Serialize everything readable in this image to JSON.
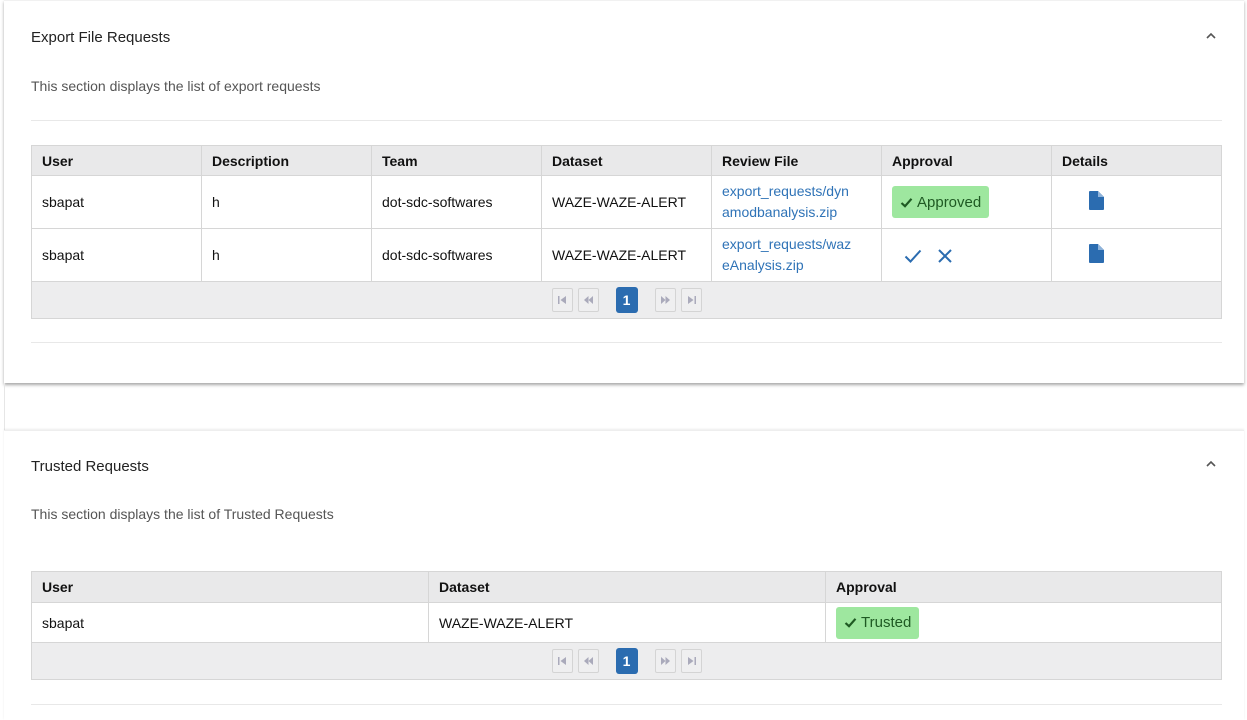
{
  "export_section": {
    "title": "Export File Requests",
    "description": "This section displays the list of export requests",
    "columns": [
      "User",
      "Description",
      "Team",
      "Dataset",
      "Review File",
      "Approval",
      "Details"
    ],
    "rows": [
      {
        "user": "sbapat",
        "description": "h",
        "team": "dot-sdc-softwares",
        "dataset": "WAZE-WAZE-ALERT",
        "review_file_line1": "export_requests/dyn",
        "review_file_line2": "amodbanalysis.zip",
        "approval": "Approved"
      },
      {
        "user": "sbapat",
        "description": "h",
        "team": "dot-sdc-softwares",
        "dataset": "WAZE-WAZE-ALERT",
        "review_file_line1": "export_requests/waz",
        "review_file_line2": "eAnalysis.zip",
        "approval": ""
      }
    ],
    "pager": {
      "current_page": "1"
    }
  },
  "trusted_section": {
    "title": "Trusted Requests",
    "description": "This section displays the list of Trusted Requests",
    "columns": [
      "User",
      "Dataset",
      "Approval"
    ],
    "rows": [
      {
        "user": "sbapat",
        "dataset": "WAZE-WAZE-ALERT",
        "approval": "Trusted"
      }
    ],
    "pager": {
      "current_page": "1"
    }
  },
  "colors": {
    "link": "#2f73b7",
    "badge_bg": "#9ee79f",
    "badge_text": "#1f5a23",
    "page_active": "#2b6cb0",
    "icon_blue": "#2b6cb0"
  },
  "icons": [
    "chevron-up-icon",
    "check-icon",
    "close-icon",
    "document-icon",
    "first-page-icon",
    "prev-page-icon",
    "next-page-icon",
    "last-page-icon"
  ]
}
